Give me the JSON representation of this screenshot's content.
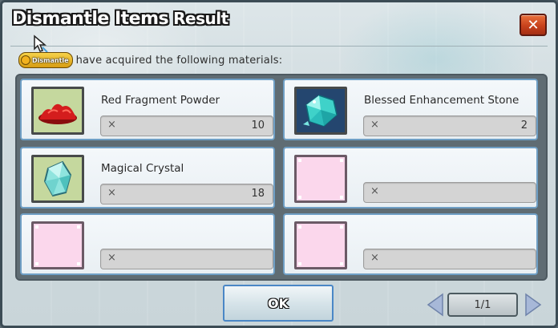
{
  "window": {
    "title_main": "Dismantle Items",
    "title_sub": "Result",
    "close_label": "✕"
  },
  "message": {
    "badge_label": "Dismantle",
    "text": "have acquired the following materials:"
  },
  "items": [
    {
      "name": "Red Fragment Powder",
      "qty_prefix": "×",
      "qty": "10",
      "icon": "red-powder-icon"
    },
    {
      "name": "Blessed Enhancement Stone",
      "qty_prefix": "×",
      "qty": "2",
      "icon": "enhancement-stone-icon"
    },
    {
      "name": "Magical Crystal",
      "qty_prefix": "×",
      "qty": "18",
      "icon": "crystal-icon"
    },
    {
      "name": "",
      "qty_prefix": "×",
      "qty": "",
      "icon": "empty-slot-icon"
    },
    {
      "name": "",
      "qty_prefix": "×",
      "qty": "",
      "icon": "empty-slot-icon"
    },
    {
      "name": "",
      "qty_prefix": "×",
      "qty": "",
      "icon": "empty-slot-icon"
    }
  ],
  "footer": {
    "ok_label": "OK",
    "page_indicator": "1/1"
  },
  "colors": {
    "slot_border": "#6f9fc5",
    "empty_slot_fill": "#fbd7ec",
    "close_button": "#c8421c"
  }
}
